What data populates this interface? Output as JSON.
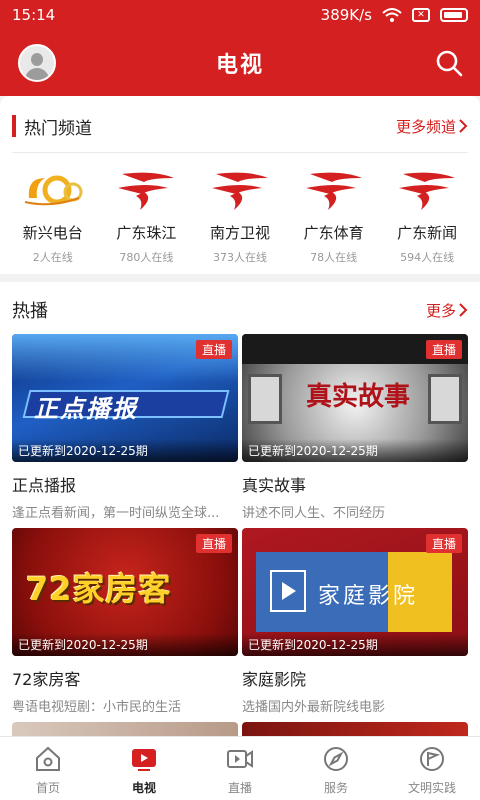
{
  "status_bar": {
    "time": "15:14",
    "speed": "389K/s"
  },
  "app_bar": {
    "title": "电视"
  },
  "hot_channels": {
    "title": "热门频道",
    "more": "更多频道",
    "items": [
      {
        "name": "新兴电台",
        "online": "2人在线"
      },
      {
        "name": "广东珠江",
        "online": "780人在线"
      },
      {
        "name": "南方卫视",
        "online": "373人在线"
      },
      {
        "name": "广东体育",
        "online": "78人在线"
      },
      {
        "name": "广东新闻",
        "online": "594人在线"
      }
    ]
  },
  "hot": {
    "title": "热播",
    "more": "更多",
    "items": [
      {
        "title": "正点播报",
        "desc": "逢正点看新闻，第一时间纵览全球...",
        "badge": "直播",
        "updated": "已更新到2020-12-25期",
        "art": "正点播报"
      },
      {
        "title": "真实故事",
        "desc": "讲述不同人生、不同经历",
        "badge": "直播",
        "updated": "已更新到2020-12-25期",
        "art": "真实故事"
      },
      {
        "title": "72家房客",
        "desc": "粤语电视短剧：小市民的生活",
        "badge": "直播",
        "updated": "已更新到2020-12-25期",
        "art": "72家房客"
      },
      {
        "title": "家庭影院",
        "desc": "选播国内外最新院线电影",
        "badge": "直播",
        "updated": "已更新到2020-12-25期",
        "art": "家庭影院"
      }
    ]
  },
  "bottom_nav": {
    "items": [
      {
        "label": "首页"
      },
      {
        "label": "电视"
      },
      {
        "label": "直播"
      },
      {
        "label": "服务"
      },
      {
        "label": "文明实践"
      }
    ]
  },
  "colors": {
    "brand_red": "#d42020"
  }
}
